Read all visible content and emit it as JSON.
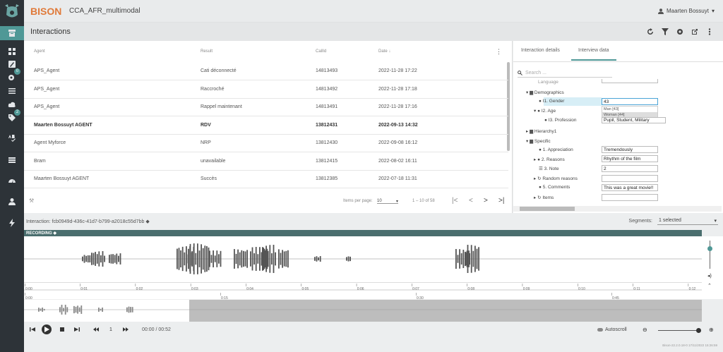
{
  "app": {
    "brand": "BISON",
    "project": "CCA_AFR_multimodal",
    "user": "Maarten Bossuyt",
    "footer": "Bison-22.2.0.18-0 17/11/2022 15:26:59"
  },
  "sidebar": {
    "badges": [
      "0",
      "2"
    ]
  },
  "page": {
    "title": "Interactions"
  },
  "table": {
    "headers": {
      "agent": "Agent",
      "result": "Result",
      "callid": "CallId",
      "date": "Date"
    },
    "rows": [
      {
        "agent": "APS_Agent",
        "result": "Cati déconnecté",
        "callid": "14813493",
        "date": "2022-11-28 17:22"
      },
      {
        "agent": "APS_Agent",
        "result": "Raccroché",
        "callid": "14813492",
        "date": "2022-11-28 17:18"
      },
      {
        "agent": "APS_Agent",
        "result": "Rappel maintenant",
        "callid": "14813491",
        "date": "2022-11-28 17:16"
      },
      {
        "agent": "Maarten Bossuyt AGENT",
        "result": "RDV",
        "callid": "13812431",
        "date": "2022-09-13 14:32"
      },
      {
        "agent": "Agent Myforce",
        "result": "NRP",
        "callid": "13812430",
        "date": "2022-09-08 16:12"
      },
      {
        "agent": "Bram",
        "result": "unavailable",
        "callid": "13812415",
        "date": "2022-08-02 16:11"
      },
      {
        "agent": "Maarten Bossuyt AGENT",
        "result": "Succès",
        "callid": "13812385",
        "date": "2022-07-18 11:31"
      }
    ],
    "pager": {
      "items_label": "Items per page:",
      "items_value": "10",
      "range": "1 – 10 of 58"
    }
  },
  "details": {
    "tabs": [
      "Interaction details",
      "Interview data"
    ],
    "search_placeholder": "Search ...",
    "tree": {
      "language": "Language",
      "demographics": "Demographics",
      "gender": "I1. Gender",
      "gender_value": "43",
      "gender_options": [
        "Man [43]",
        "Woman [44]"
      ],
      "age": "I2. Age",
      "profession": "I3. Profession",
      "profession_value": "Pupil, Student, Military",
      "hierarchy": "Hierarchy1",
      "specific": "Specific",
      "appreciation": "1. Appreciation",
      "appreciation_value": "Tremendously",
      "reasons": "2. Reasons",
      "reasons_value": "Rhythm of the film",
      "note": "3. Note",
      "note_value": "2",
      "random": "Random reasons",
      "comments": "5. Comments",
      "comments_value": "This was a great movie!!",
      "items": "Items"
    }
  },
  "interaction": {
    "label": "Interaction: fcb0949d-436c-41d7-b799-a2018c55d7bb",
    "segments_label": "Segments:",
    "segments_value": "1 selected"
  },
  "recording": {
    "label": "RECORDING"
  },
  "timeline": {
    "top_ticks": [
      "0:00",
      "0:01",
      "0:02",
      "0:03",
      "0:04",
      "0:05",
      "0:06",
      "0:07",
      "0:08",
      "0:09",
      "0:10",
      "0:11",
      "0:12"
    ],
    "bottom_ticks": [
      "0:00",
      "0:15",
      "0:30",
      "0:45"
    ]
  },
  "player": {
    "speed": "1",
    "time": "00:00 / 00:52",
    "autoscroll": "Autoscroll"
  }
}
